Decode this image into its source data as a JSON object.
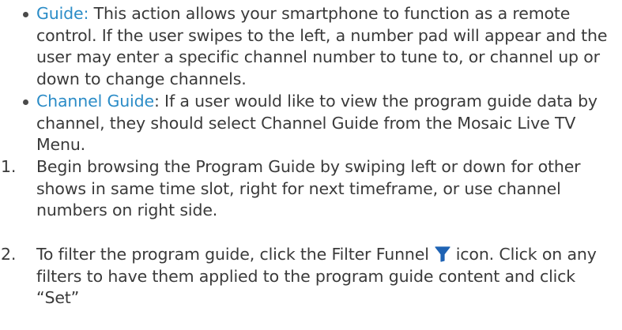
{
  "items": [
    {
      "type": "bullet",
      "link": "Guide:",
      "text": " This action allows your smartphone to function as a remote control. If the user swipes to the left, a number pad will appear and the user may enter a specific channel number to tune to, or channel up or down to change channels."
    },
    {
      "type": "bullet",
      "link": "Channel Guide",
      "text": ": If a user would like to view the program guide data by channel, they should select Channel Guide from the Mosaic Live TV Menu."
    },
    {
      "type": "numbered",
      "number": "1.",
      "text": "Begin browsing the Program Guide by swiping left or down for other shows in same time slot, right for next timeframe, or use channel numbers on right side."
    },
    {
      "type": "numbered",
      "number": "2.",
      "text_before_icon": "To filter the program guide, click the Filter Funnel",
      "icon": "filter-funnel-icon",
      "text_after_icon": "icon. Click on any filters to have them applied to the program guide content and click “Set”"
    }
  ],
  "colors": {
    "link": "#2b8cc7",
    "icon": "#1e63b4",
    "text": "#3a3a3a"
  }
}
